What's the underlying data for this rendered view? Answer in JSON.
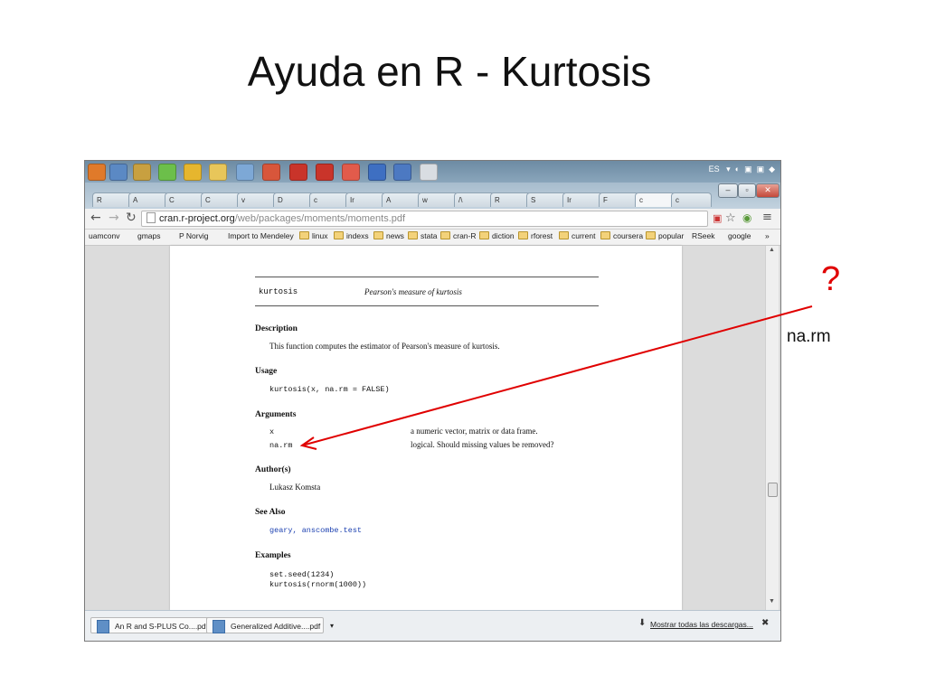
{
  "slide": {
    "title": "Ayuda en R - Kurtosis",
    "question_mark": "?",
    "annotation": "na.rm"
  },
  "taskbar": {
    "tray_text": "ES"
  },
  "tabs": [
    {
      "label": "R"
    },
    {
      "label": "A"
    },
    {
      "label": "C"
    },
    {
      "label": "C"
    },
    {
      "label": "v"
    },
    {
      "label": "D"
    },
    {
      "label": "c"
    },
    {
      "label": "Ir"
    },
    {
      "label": "A"
    },
    {
      "label": "w"
    },
    {
      "label": "/\\"
    },
    {
      "label": "R"
    },
    {
      "label": "S"
    },
    {
      "label": "Ir"
    },
    {
      "label": "F"
    },
    {
      "label": "c"
    },
    {
      "label": "c"
    }
  ],
  "address": {
    "host": "cran.r-project.org",
    "path": "/web/packages/moments/moments.pdf"
  },
  "bookmarks": [
    {
      "label": "uamconv"
    },
    {
      "label": "gmaps"
    },
    {
      "label": "P Norvig"
    },
    {
      "label": "Import to Mendeley"
    },
    {
      "label": "linux"
    },
    {
      "label": "indexs"
    },
    {
      "label": "news"
    },
    {
      "label": "stata"
    },
    {
      "label": "cran-R"
    },
    {
      "label": "diction"
    },
    {
      "label": "rforest"
    },
    {
      "label": "current"
    },
    {
      "label": "coursera"
    },
    {
      "label": "popular"
    },
    {
      "label": "RSeek"
    },
    {
      "label": "google"
    }
  ],
  "doc": {
    "fn_name": "kurtosis",
    "fn_title": "Pearson's measure of kurtosis",
    "description_heading": "Description",
    "description_text": "This function computes the estimator of Pearson's measure of kurtosis.",
    "usage_heading": "Usage",
    "usage_code": "kurtosis(x, na.rm = FALSE)",
    "arguments_heading": "Arguments",
    "arg1_name": "x",
    "arg1_desc": "a numeric vector, matrix or data frame.",
    "arg2_name": "na.rm",
    "arg2_desc": "logical. Should missing values be removed?",
    "author_heading": "Author(s)",
    "author_text": "Lukasz Komsta",
    "seealso_heading": "See Also",
    "seealso_links": "geary, anscombe.test",
    "examples_heading": "Examples",
    "example_line1": "set.seed(1234)",
    "example_line2": "kurtosis(rnorm(1000))"
  },
  "downloads": {
    "item1": "An R and S-PLUS Co....pdf",
    "item2": "Generalized Additive....pdf",
    "show_all": "Mostrar todas las descargas...",
    "close": "✖"
  },
  "colors": {
    "accent_red": "#e00000",
    "link_blue": "#1a3fb0"
  }
}
